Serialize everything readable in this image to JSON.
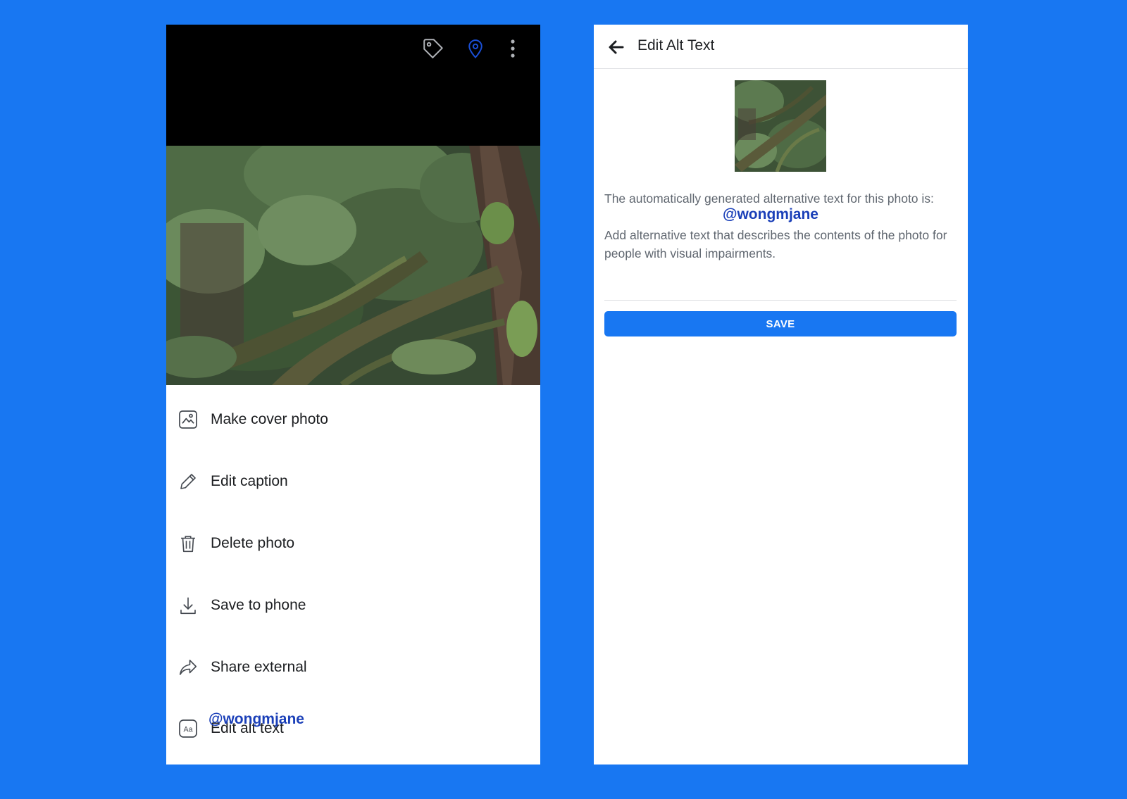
{
  "left": {
    "header_icons": [
      "tag-icon",
      "location-pin-icon",
      "more-vertical-icon"
    ],
    "menu": [
      {
        "label": "Make cover photo",
        "icon": "cover-photo-icon"
      },
      {
        "label": "Edit caption",
        "icon": "pencil-icon"
      },
      {
        "label": "Delete photo",
        "icon": "trash-icon"
      },
      {
        "label": "Save to phone",
        "icon": "download-icon"
      },
      {
        "label": "Share external",
        "icon": "share-icon"
      },
      {
        "label": "Edit alt text",
        "icon": "alt-text-icon"
      }
    ],
    "watermark": "@wongmjane"
  },
  "right": {
    "title": "Edit Alt Text",
    "back_icon": "back-arrow-icon",
    "description_line": "The automatically generated alternative text for this photo is:",
    "watermark": "@wongmjane",
    "instructions": "Add alternative text that describes the contents of the photo for people with visual impairments.",
    "input_value": "",
    "save_label": "SAVE"
  },
  "colors": {
    "background": "#1877F2",
    "accent": "#1877F2",
    "watermark": "#1a3fb8",
    "pin_icon": "#1a4fd6"
  }
}
